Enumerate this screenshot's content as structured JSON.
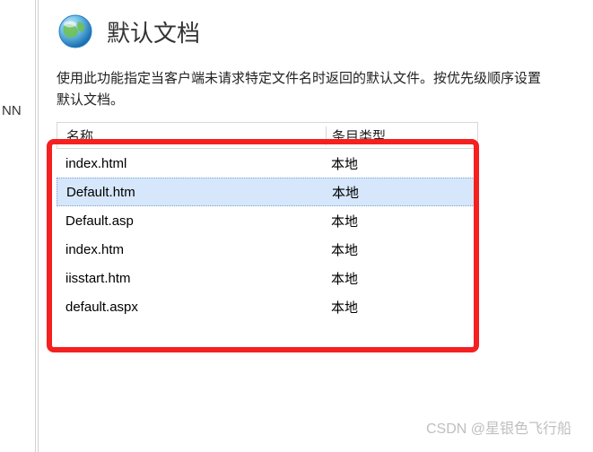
{
  "left_label": "NN",
  "header": {
    "title": "默认文档"
  },
  "description": "使用此功能指定当客户端未请求特定文件名时返回的默认文件。按优先级顺序设置默认文档。",
  "table": {
    "columns": {
      "name": "名称",
      "type": "条目类型"
    },
    "rows": [
      {
        "name": "index.html",
        "type": "本地",
        "selected": false
      },
      {
        "name": "Default.htm",
        "type": "本地",
        "selected": true
      },
      {
        "name": "Default.asp",
        "type": "本地",
        "selected": false
      },
      {
        "name": "index.htm",
        "type": "本地",
        "selected": false
      },
      {
        "name": "iisstart.htm",
        "type": "本地",
        "selected": false
      },
      {
        "name": "default.aspx",
        "type": "本地",
        "selected": false
      }
    ]
  },
  "watermark": "CSDN @星银色飞行船"
}
